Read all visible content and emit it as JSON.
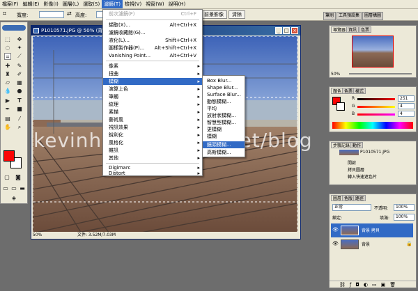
{
  "menubar": {
    "items": [
      "檔案(F)",
      "編輯(E)",
      "影像(I)",
      "圖層(L)",
      "選取(S)",
      "濾鏡(T)",
      "檢視(V)",
      "視窗(W)",
      "說明(H)"
    ],
    "active_index": 5
  },
  "options": {
    "width_label": "寬度:",
    "height_label": "高度:",
    "front_image_button": "前景影像",
    "clear_button": "清除"
  },
  "palette_well": {
    "tabs": [
      "筆刷",
      "工具預設集",
      "圖層構圖"
    ]
  },
  "document": {
    "title": "P1010571.JPG @ 50% (背景",
    "zoom": "50%",
    "file_info": "文件: 3.52M/7.03M"
  },
  "watermark": "kevinhome.pixnet.net/blog",
  "filter_menu": {
    "top": [
      {
        "label": "前次濾鏡(F)",
        "shortcut": "Ctrl+F",
        "disabled": true
      }
    ],
    "group2": [
      {
        "label": "擷取(X)...",
        "shortcut": "Alt+Ctrl+X"
      },
      {
        "label": "濾鏡收藏館(G)...",
        "shortcut": ""
      },
      {
        "label": "液化(L)...",
        "shortcut": "Shift+Ctrl+X"
      },
      {
        "label": "圖樣製作器(P)...",
        "shortcut": "Alt+Shift+Ctrl+X"
      },
      {
        "label": "Vanishing Point...",
        "shortcut": "Alt+Ctrl+V"
      }
    ],
    "group3": [
      "像素",
      "扭曲",
      "模糊",
      "演算上色",
      "筆觸",
      "紋理",
      "素描",
      "藝術風",
      "視訊效果",
      "銳利化",
      "風格化",
      "雜訊",
      "其他"
    ],
    "group4": [
      "Digimarc",
      "Distort"
    ],
    "highlighted": "模糊"
  },
  "blur_submenu": {
    "items": [
      "Box Blur...",
      "Shape Blur...",
      "Surface Blur...",
      "動態模糊...",
      "平均",
      "放射狀模糊...",
      "智慧型模糊...",
      "更模糊",
      "模糊",
      "鏡頭模糊...",
      "高斯模糊..."
    ],
    "highlighted": "鏡頭模糊..."
  },
  "navigator": {
    "tabs": [
      "導覽器",
      "資訊",
      "色票"
    ],
    "zoom": "50%"
  },
  "color_panel": {
    "tabs": [
      "顏色",
      "色票",
      "樣式"
    ],
    "channels": [
      {
        "name": "R",
        "value": "251"
      },
      {
        "name": "G",
        "value": "4"
      },
      {
        "name": "B",
        "value": "4"
      }
    ],
    "foreground": "#fb0404"
  },
  "history_panel": {
    "tabs": [
      "步驟記錄",
      "動作"
    ],
    "snapshot": "P1010571.JPG",
    "items": [
      "開啟",
      "拷貝圖層",
      "轉入快速遮色片"
    ]
  },
  "layers_panel": {
    "tabs": [
      "圖層",
      "色版",
      "路徑"
    ],
    "blend_mode": "正常",
    "opacity_label": "不透明:",
    "opacity": "100%",
    "fill_label": "填滿:",
    "fill": "100%",
    "lock_label": "鎖定:",
    "layers": [
      {
        "name": "背景 拷貝",
        "selected": true
      },
      {
        "name": "背景",
        "selected": false
      }
    ]
  }
}
